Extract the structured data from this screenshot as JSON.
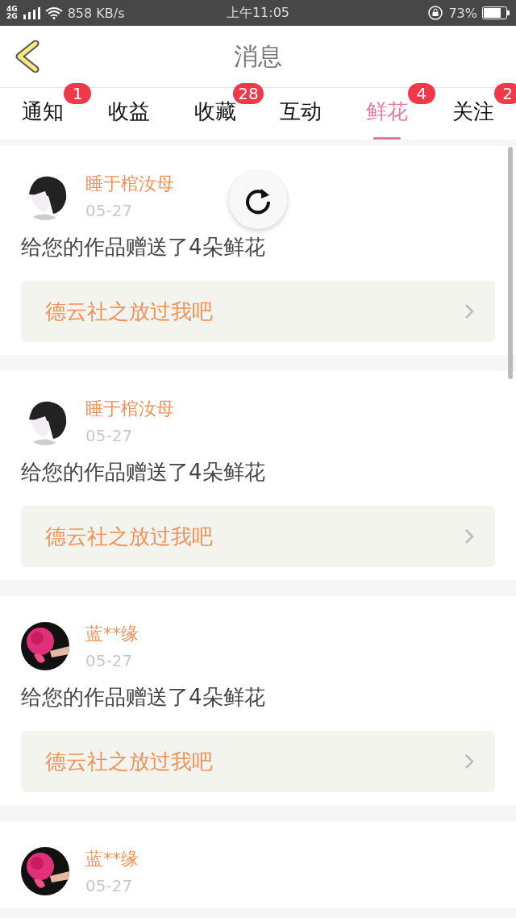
{
  "status_bar": {
    "network_top": "4G",
    "network_bottom": "2G",
    "speed": "858 KB/s",
    "time": "上午11:05",
    "battery": "73%"
  },
  "header": {
    "title": "消息"
  },
  "tabs": [
    {
      "label": "通知",
      "badge": "1",
      "selected": false
    },
    {
      "label": "收益",
      "selected": false
    },
    {
      "label": "收藏",
      "badge": "28",
      "selected": false
    },
    {
      "label": "互动",
      "selected": false
    },
    {
      "label": "鲜花",
      "badge": "4",
      "selected": true
    },
    {
      "label": "关注",
      "badge": "2",
      "selected": false
    }
  ],
  "messages": [
    {
      "avatar": {
        "kind": "sketch"
      },
      "name": "睡于棺汝母",
      "date": "05-27",
      "text": "给您的作品赠送了4朵鲜花",
      "work": "德云社之放过我吧"
    },
    {
      "avatar": {
        "kind": "sketch"
      },
      "name": "睡于棺汝母",
      "date": "05-27",
      "text": "给您的作品赠送了4朵鲜花",
      "work": "德云社之放过我吧"
    },
    {
      "avatar": {
        "kind": "rose"
      },
      "name": "蓝**缘",
      "date": "05-27",
      "text": "给您的作品赠送了4朵鲜花",
      "work": "德云社之放过我吧"
    },
    {
      "avatar": {
        "kind": "rose"
      },
      "name": "蓝**缘",
      "date": "05-27"
    }
  ]
}
